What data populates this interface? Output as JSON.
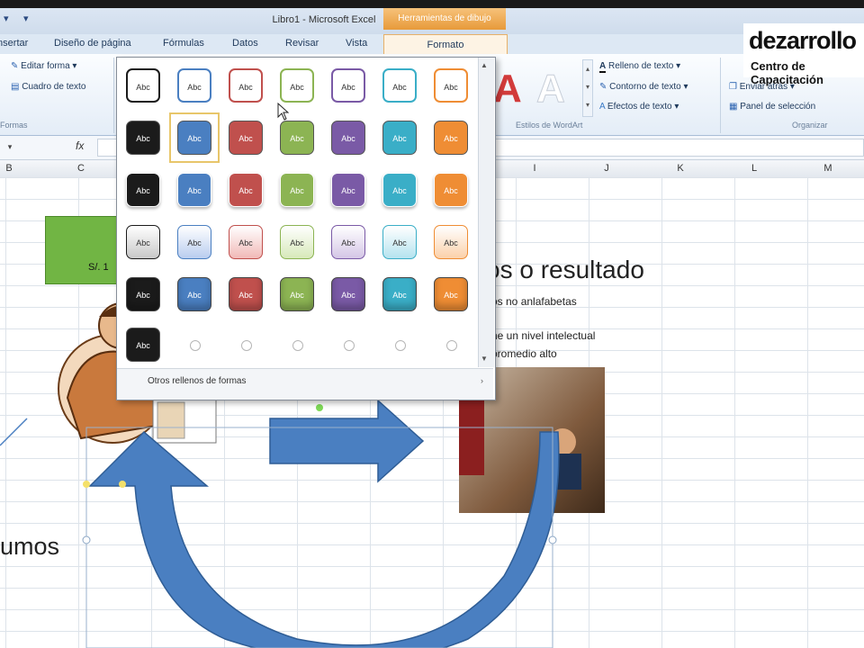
{
  "window": {
    "title": "Libro1 - Microsoft Excel",
    "context_tab": "Herramientas de dibujo"
  },
  "tabs": [
    "Insertar",
    "Diseño de página",
    "Fórmulas",
    "Datos",
    "Revisar",
    "Vista"
  ],
  "active_tab": "Formato",
  "ribbon": {
    "editar_forma": "Editar forma",
    "cuadro_texto": "Cuadro de texto",
    "grupo_formas": "Formas",
    "relleno_texto": "Relleno de texto",
    "contorno_texto": "Contorno de texto",
    "efectos_texto": "Efectos de texto",
    "grupo_wordart": "Estilos de WordArt",
    "enviar_atras": "Enviar atrás",
    "panel_seleccion": "Panel de selección",
    "grupo_organizar": "Organizar",
    "wordart_letter": "A"
  },
  "logo": {
    "main": "dezarrollo",
    "sub": "Centro de Capacitación"
  },
  "formula_bar": {
    "fx": "fx"
  },
  "columns": [
    "B",
    "C",
    "I",
    "J",
    "K",
    "L",
    "M"
  ],
  "sheet": {
    "green_box": "S/. 1",
    "heading": "os o resultado",
    "line1": "os no anlafabetas",
    "line2": "ne un nivel intelectual",
    "line3": "promedio alto",
    "left_text": "umos"
  },
  "gallery": {
    "swatch_label": "Abc",
    "more_fills": "Otros rellenos de formas",
    "colors": [
      "#1b1b1b",
      "#4a7fc1",
      "#c0504d",
      "#8cb453",
      "#7a5aa6",
      "#3aaec7",
      "#ef8d34"
    ],
    "light_colors": [
      "#c8c8c8",
      "#b9cdef",
      "#f1b9b7",
      "#d7e9b9",
      "#d4c6e6",
      "#b5e3ef",
      "#fbd1aa"
    ]
  }
}
